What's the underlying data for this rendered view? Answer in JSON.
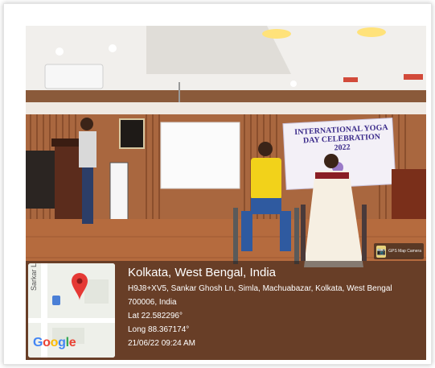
{
  "banner": {
    "lines": [
      "INTERNATIONAL YOGA DAY CELEBRATION",
      "2022"
    ]
  },
  "geotag": {
    "place": "Kolkata, West Bengal, India",
    "address_line1": "H9J8+XV5, Sankar Ghosh Ln, Simla, Machuabazar, Kolkata, West Bengal",
    "address_line2": "700006, India",
    "lat": "Lat 22.582296°",
    "long": "Long 88.367174°",
    "datetime": "21/06/22 09:24 AM"
  },
  "map": {
    "street_label": "Sarkar Ln",
    "google_letters": [
      {
        "ch": "G",
        "color": "#4285F4"
      },
      {
        "ch": "o",
        "color": "#EA4335"
      },
      {
        "ch": "o",
        "color": "#FBBC05"
      },
      {
        "ch": "g",
        "color": "#4285F4"
      },
      {
        "ch": "l",
        "color": "#34A853"
      },
      {
        "ch": "e",
        "color": "#EA4335"
      }
    ],
    "pin_color": "#E53935"
  },
  "camera_badge": {
    "label": "GPS Map Camera"
  }
}
